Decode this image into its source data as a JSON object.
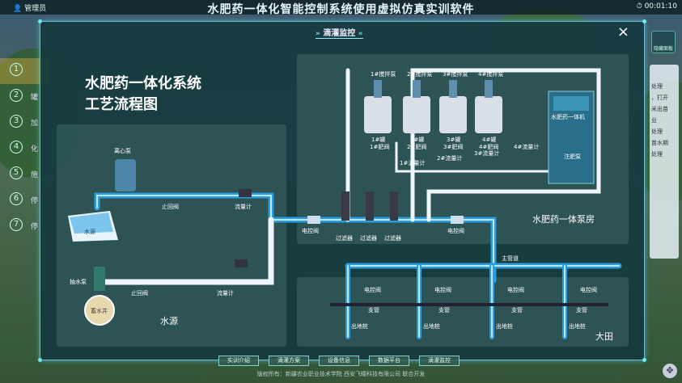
{
  "topbar": {
    "user_label": "管理员",
    "title": "水肥药一体化智能控制系统使用虚拟仿真实训软件",
    "clock": "00:01:10"
  },
  "sidebar": {
    "items": [
      {
        "num": "1",
        "label": ""
      },
      {
        "num": "2",
        "label": "罐"
      },
      {
        "num": "3",
        "label": "加"
      },
      {
        "num": "4",
        "label": "化"
      },
      {
        "num": "5",
        "label": "施"
      },
      {
        "num": "6",
        "label": "停"
      },
      {
        "num": "7",
        "label": "停"
      }
    ]
  },
  "right_panel": {
    "hide_label": "隐藏面板",
    "texts": [
      "处理",
      "，打开",
      "米出苗",
      "业",
      "处理",
      "苗水期",
      "处理"
    ]
  },
  "modal": {
    "header": "滴灌监控",
    "close_symbol": "×",
    "title_line1": "水肥药一体化系统",
    "title_line2": "工艺流程图",
    "water_source": {
      "name": "水源",
      "centrifugal_pump": "离心泵",
      "check_valve": "止回阀",
      "flow_meter": "流量计",
      "pool": "水源",
      "suction_pump": "抽水泵",
      "well": "蓄水井",
      "check_valve2": "止回阀",
      "flow_meter2": "流量计"
    },
    "filters": {
      "electric_valve": "电控阀",
      "filter1": "过滤器",
      "filter2": "过滤器",
      "filter3": "过滤器",
      "electric_valve2": "电控阀"
    },
    "pump_room": {
      "name": "水肥药一体泵房",
      "machine": "水肥药一体机",
      "injection_pump": "注肥泵",
      "mixers": [
        "1#搅拌泵",
        "2#搅拌泵",
        "3#搅拌泵",
        "4#搅拌泵"
      ],
      "tanks": [
        "1#罐",
        "2#罐",
        "3#罐",
        "4#罐"
      ],
      "fert_valves": [
        "1#肥阀",
        "2#肥阀",
        "3#肥阀",
        "4#肥阀"
      ],
      "flow_meters": [
        "1#流量计",
        "2#流量计",
        "3#流量计",
        "4#流量计"
      ]
    },
    "field": {
      "name": "大田",
      "main_pipe": "主管道",
      "branches": [
        {
          "valve": "电控阀",
          "pipe": "支管",
          "outlet": "出地桩"
        },
        {
          "valve": "电控阀",
          "pipe": "支管",
          "outlet": "出地桩"
        },
        {
          "valve": "电控阀",
          "pipe": "支管",
          "outlet": "出地桩"
        },
        {
          "valve": "电控阀",
          "pipe": "支管",
          "outlet": "出地桩"
        }
      ]
    }
  },
  "bottom_buttons": [
    "实训介绍",
    "滴灌方案",
    "设备信息",
    "数据平台",
    "滴灌监控"
  ],
  "footer": "版权所有：新疆农业职业技术学院  西安飞瞳科技有限公司  联合开发",
  "colors": {
    "pipe": "#2a9de0",
    "pipe_light": "#bfe8ff",
    "modal_bg": "#163a3e",
    "accent": "#7de"
  }
}
